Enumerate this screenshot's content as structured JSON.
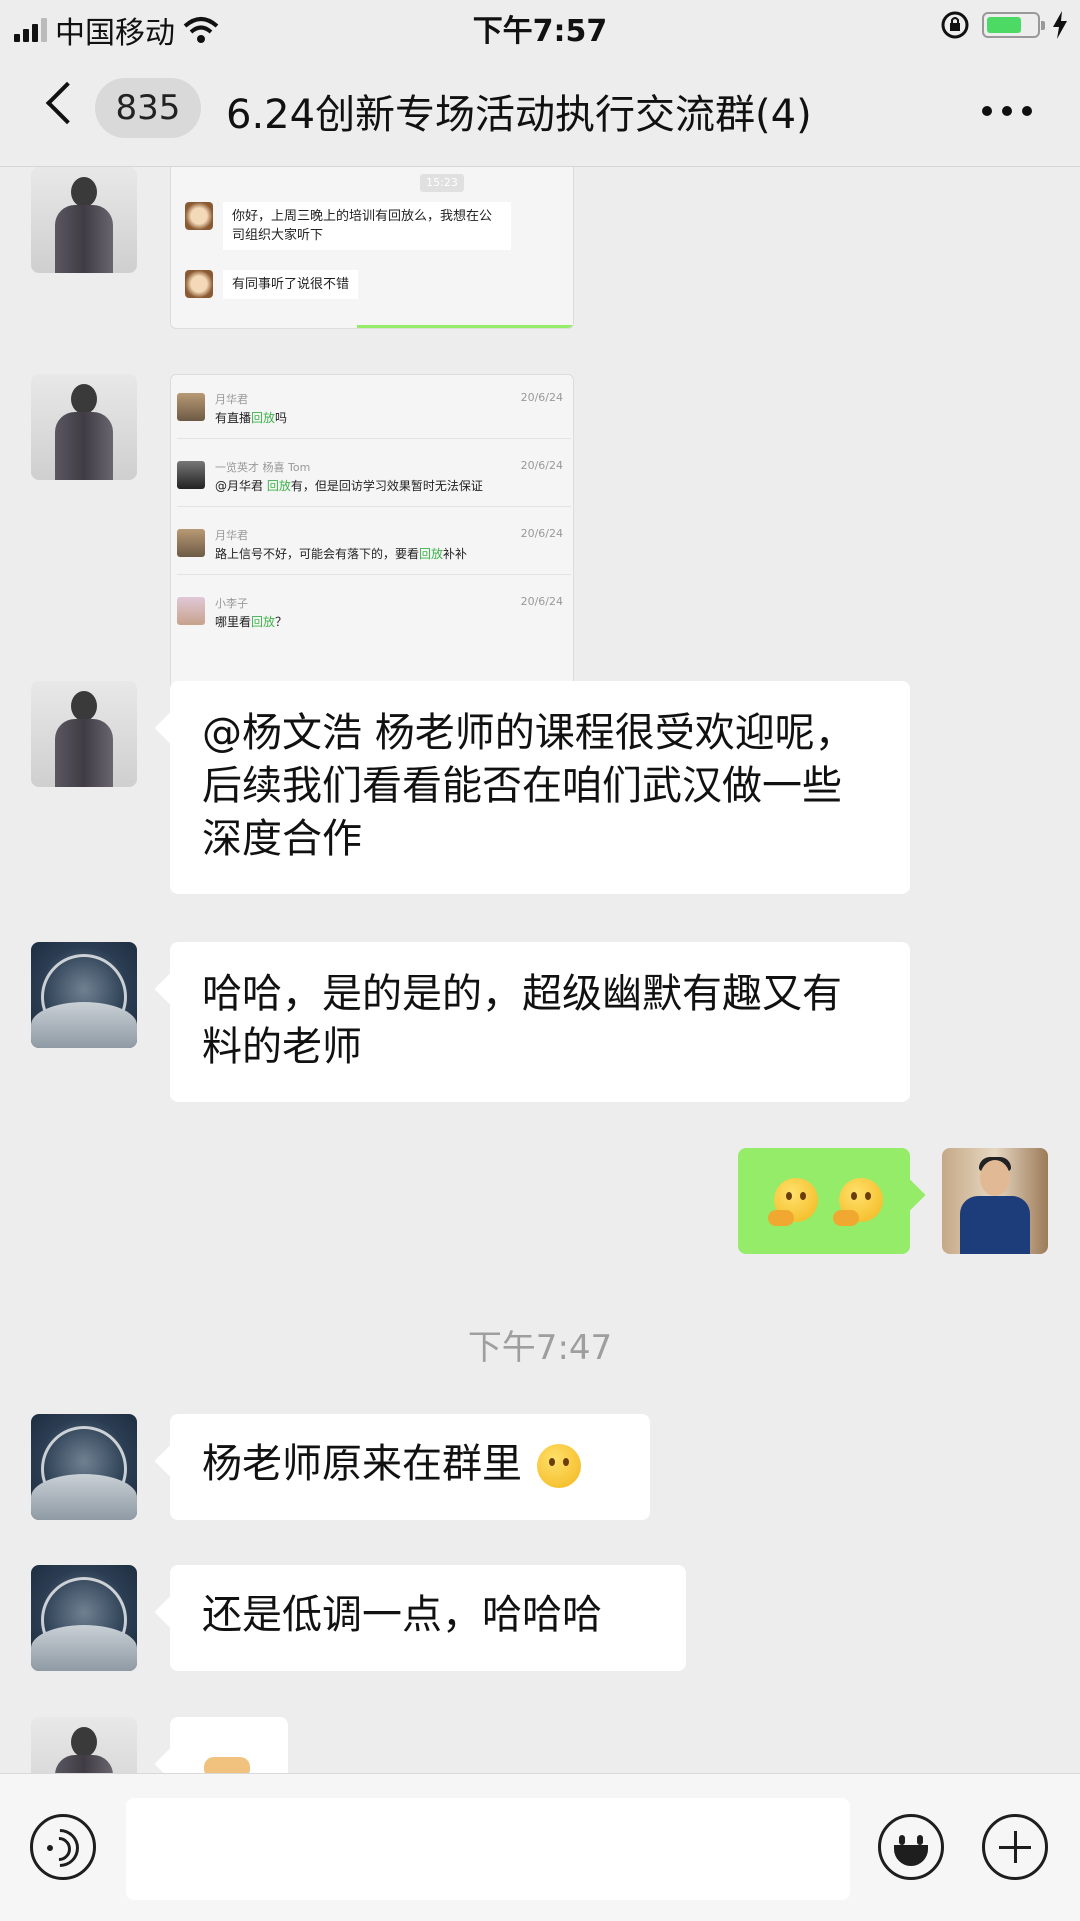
{
  "status_bar": {
    "carrier": "中国移动",
    "time": "下午7:57"
  },
  "nav": {
    "back_badge": "835",
    "title": "6.24创新专场活动执行交流群(4)"
  },
  "chat": {
    "shot1": {
      "stamp": "15:23",
      "line1": "你好，上周三晚上的培训有回放么，我想在公司组织大家听下",
      "line2": "有同事听了说很不错"
    },
    "shot2": {
      "rows": [
        {
          "name": "月华君",
          "date": "20/6/24",
          "pre": "有直播",
          "hl": "回放",
          "post": "吗"
        },
        {
          "name": "一览英才  杨喜 Tom",
          "date": "20/6/24",
          "pre": "@月华君 ",
          "hl": "回放",
          "post": "有，但是回访学习效果暂时无法保证"
        },
        {
          "name": "月华君",
          "date": "20/6/24",
          "pre": "路上信号不好，可能会有落下的，要看",
          "hl": "回放",
          "post": "补补"
        },
        {
          "name": "小李子",
          "date": "20/6/24",
          "pre": "哪里看",
          "hl": "回放",
          "post": "？"
        }
      ]
    },
    "msg_yang": "@杨文浩 杨老师的课程很受欢迎呢，后续我们看看能否在咱们武汉做一些深度合作",
    "msg_haha": "哈哈，是的是的，超级幽默有趣又有料的老师",
    "time_sep": "下午7:47",
    "msg_inside": "杨老师原来在群里",
    "msg_lowkey": "还是低调一点，哈哈哈"
  },
  "colors": {
    "background": "#ededed",
    "sent_bubble": "#95ec69",
    "received_bubble": "#ffffff",
    "highlight": "#3cb34a"
  }
}
